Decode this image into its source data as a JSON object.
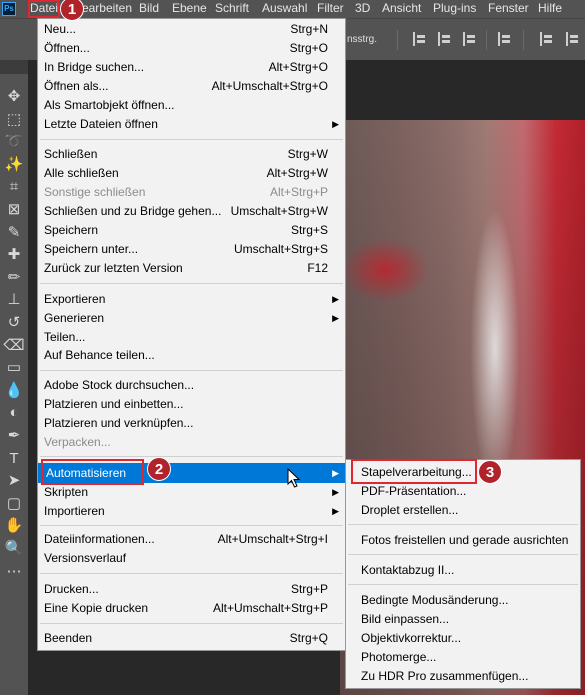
{
  "app": {
    "logo": "Ps"
  },
  "menubar": [
    "Datei",
    "Bearbeiten",
    "Bild",
    "Ebene",
    "Schrift",
    "Auswahl",
    "Filter",
    "3D",
    "Ansicht",
    "Plug-ins",
    "Fenster",
    "Hilfe"
  ],
  "optionsbar": {
    "text": "nsstrg."
  },
  "tools": [
    "move-icon",
    "marquee-icon",
    "lasso-icon",
    "magic-wand-icon",
    "crop-icon",
    "frame-icon",
    "eyedropper-icon",
    "healing-icon",
    "brush-icon",
    "stamp-icon",
    "history-brush-icon",
    "eraser-icon",
    "gradient-icon",
    "blur-icon",
    "dodge-icon",
    "pen-icon",
    "type-icon",
    "path-select-icon",
    "rectangle-icon",
    "hand-icon",
    "zoom-icon",
    "more-icon"
  ],
  "file_menu": {
    "new": {
      "label": "Neu...",
      "shortcut": "Strg+N"
    },
    "open": {
      "label": "Öffnen...",
      "shortcut": "Strg+O"
    },
    "bridge": {
      "label": "In Bridge suchen...",
      "shortcut": "Alt+Strg+O"
    },
    "open_as": {
      "label": "Öffnen als...",
      "shortcut": "Alt+Umschalt+Strg+O"
    },
    "smart": {
      "label": "Als Smartobjekt öffnen...",
      "shortcut": ""
    },
    "recent": {
      "label": "Letzte Dateien öffnen",
      "shortcut": ""
    },
    "close": {
      "label": "Schließen",
      "shortcut": "Strg+W"
    },
    "close_all": {
      "label": "Alle schließen",
      "shortcut": "Alt+Strg+W"
    },
    "close_others": {
      "label": "Sonstige schließen",
      "shortcut": "Alt+Strg+P"
    },
    "close_bridge": {
      "label": "Schließen und zu Bridge gehen...",
      "shortcut": "Umschalt+Strg+W"
    },
    "save": {
      "label": "Speichern",
      "shortcut": "Strg+S"
    },
    "save_as": {
      "label": "Speichern unter...",
      "shortcut": "Umschalt+Strg+S"
    },
    "revert": {
      "label": "Zurück zur letzten Version",
      "shortcut": "F12"
    },
    "export": {
      "label": "Exportieren",
      "shortcut": ""
    },
    "generate": {
      "label": "Generieren",
      "shortcut": ""
    },
    "share": {
      "label": "Teilen...",
      "shortcut": ""
    },
    "behance": {
      "label": "Auf Behance teilen...",
      "shortcut": ""
    },
    "stock": {
      "label": "Adobe Stock durchsuchen...",
      "shortcut": ""
    },
    "place_embed": {
      "label": "Platzieren und einbetten...",
      "shortcut": ""
    },
    "place_link": {
      "label": "Platzieren und verknüpfen...",
      "shortcut": ""
    },
    "package": {
      "label": "Verpacken...",
      "shortcut": ""
    },
    "automate": {
      "label": "Automatisieren",
      "shortcut": ""
    },
    "scripts": {
      "label": "Skripten",
      "shortcut": ""
    },
    "import": {
      "label": "Importieren",
      "shortcut": ""
    },
    "file_info": {
      "label": "Dateiinformationen...",
      "shortcut": "Alt+Umschalt+Strg+I"
    },
    "version_history": {
      "label": "Versionsverlauf",
      "shortcut": ""
    },
    "print": {
      "label": "Drucken...",
      "shortcut": "Strg+P"
    },
    "print_one": {
      "label": "Eine Kopie drucken",
      "shortcut": "Alt+Umschalt+Strg+P"
    },
    "quit": {
      "label": "Beenden",
      "shortcut": "Strg+Q"
    }
  },
  "automate_submenu": {
    "batch": "Stapelverarbeitung...",
    "pdf": "PDF-Präsentation...",
    "droplet": "Droplet erstellen...",
    "crop_straighten": "Fotos freistellen und gerade ausrichten",
    "contact_sheet": "Kontaktabzug II...",
    "conditional": "Bedingte Modusänderung...",
    "fit_image": "Bild einpassen...",
    "lens": "Objektivkorrektur...",
    "photomerge": "Photomerge...",
    "hdr": "Zu HDR Pro zusammenfügen..."
  },
  "badges": [
    "1",
    "2",
    "3"
  ],
  "colors": {
    "highlight": "#0078d7",
    "callout": "#e0262e",
    "badge": "#b1232a"
  }
}
